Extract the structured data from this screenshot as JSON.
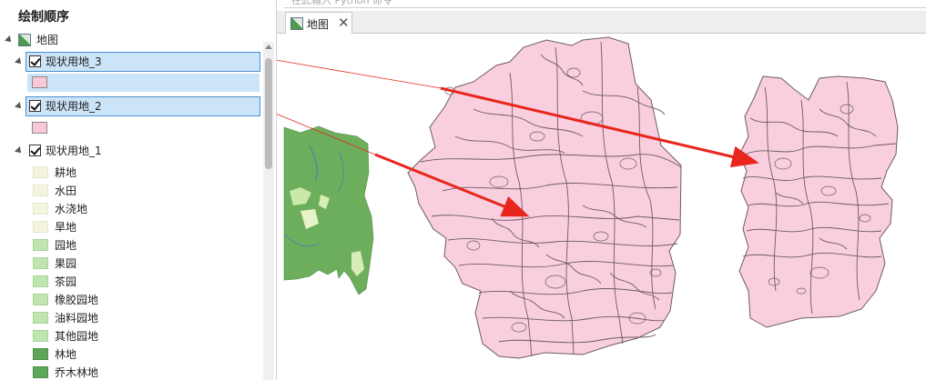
{
  "panel": {
    "title": "绘制顺序",
    "map_node": "地图",
    "layers": [
      {
        "name": "现状用地_3",
        "fill": "#f9c9da"
      },
      {
        "name": "现状用地_2",
        "fill": "#f9c9da"
      },
      {
        "name": "现状用地_1"
      }
    ],
    "legend": [
      {
        "label": "耕地",
        "color": "#f4f5de"
      },
      {
        "label": "水田",
        "color": "#f4f5de"
      },
      {
        "label": "水浇地",
        "color": "#f4f5de"
      },
      {
        "label": "旱地",
        "color": "#f4f5de"
      },
      {
        "label": "园地",
        "color": "#bfe6b0"
      },
      {
        "label": "果园",
        "color": "#bfe6b0"
      },
      {
        "label": "茶园",
        "color": "#bfe6b0"
      },
      {
        "label": "橡胶园地",
        "color": "#bfe6b0"
      },
      {
        "label": "油料园地",
        "color": "#bfe6b0"
      },
      {
        "label": "其他园地",
        "color": "#bfe6b0"
      },
      {
        "label": "林地",
        "color": "#5ea65a"
      },
      {
        "label": "乔木林地",
        "color": "#5ea65a"
      }
    ]
  },
  "top_search": {
    "placeholder": "在此输入 Python 命令"
  },
  "map_tab": {
    "label": "地图",
    "close": "✕"
  },
  "colors": {
    "parcel_fill": "#f9cfdf",
    "parcel_line": "#6e5a62",
    "forest": "#6cae5b",
    "arrow": "#e8261c"
  }
}
